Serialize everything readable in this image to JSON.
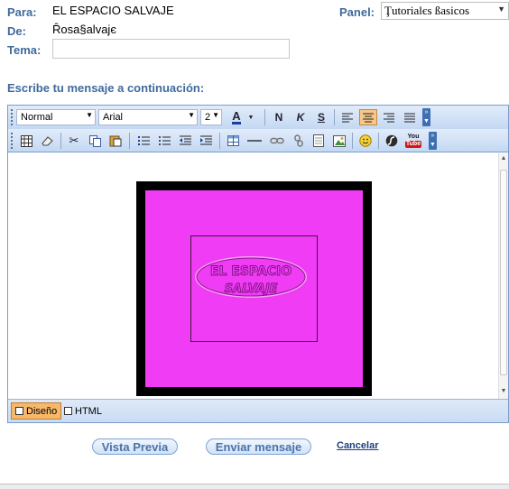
{
  "header": {
    "to_label": "Para:",
    "to_value": "EL ESPACIO SALVAJE",
    "from_label": "De:",
    "from_value": "Ȓosa§alvajє",
    "subject_label": "Tema:",
    "subject_value": "",
    "panel_label": "Panel:",
    "panel_value": "Ţutorialєs ßasicos"
  },
  "prompt": "Escribe tu mensaje a continuación:",
  "toolbar": {
    "format_value": "Normal",
    "font_value": "Arial",
    "size_value": "2",
    "bold": "N",
    "italic": "K",
    "underline": "S",
    "youtube_line1": "You",
    "youtube_line2": "Tube"
  },
  "content": {
    "logo_line1": "EL ESPACIO",
    "logo_line2": "SALVAJE",
    "frame_color": "#000000",
    "fill_color": "#f03cf5"
  },
  "modes": {
    "design": "Diseño",
    "html": "HTML"
  },
  "actions": {
    "preview": "Vista Previa",
    "send": "Enviar mensaje",
    "cancel": "Cancelar"
  },
  "colors": {
    "label_blue": "#3f6a9d",
    "toolbar_top": "#e2ecfa",
    "toolbar_bottom": "#c4d8f3",
    "active_orange": "#f6b86a"
  }
}
